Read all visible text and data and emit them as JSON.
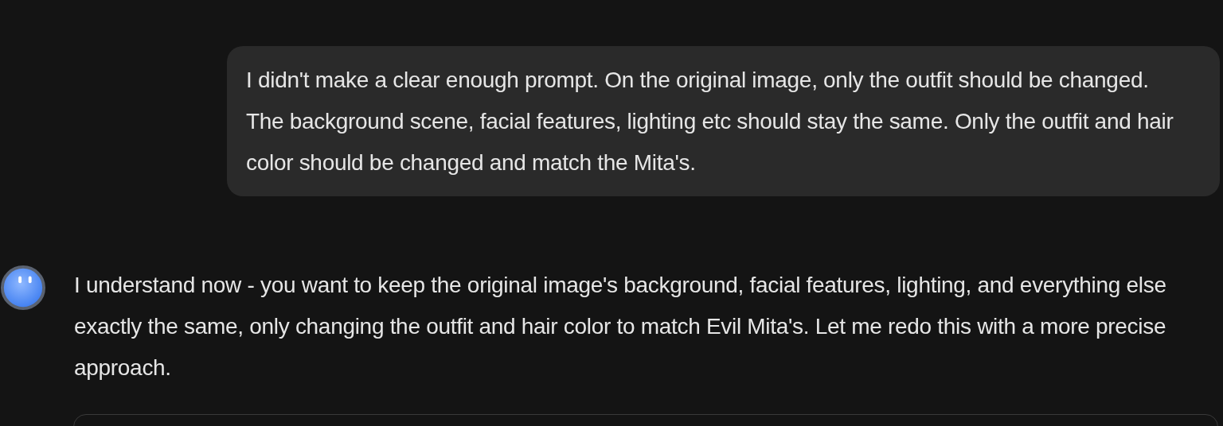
{
  "user_message": {
    "text": "I didn't make a clear enough prompt. On the original image, only the outfit should be changed. The background scene, facial features, lighting etc should stay the same. Only the outfit and hair color should be changed and match the Mita's."
  },
  "assistant_message": {
    "text": "I understand now - you want to keep the original image's background, facial features, lighting, and everything else exactly the same, only changing the outfit and hair color to match Evil Mita's. Let me redo this with a more precise approach."
  }
}
